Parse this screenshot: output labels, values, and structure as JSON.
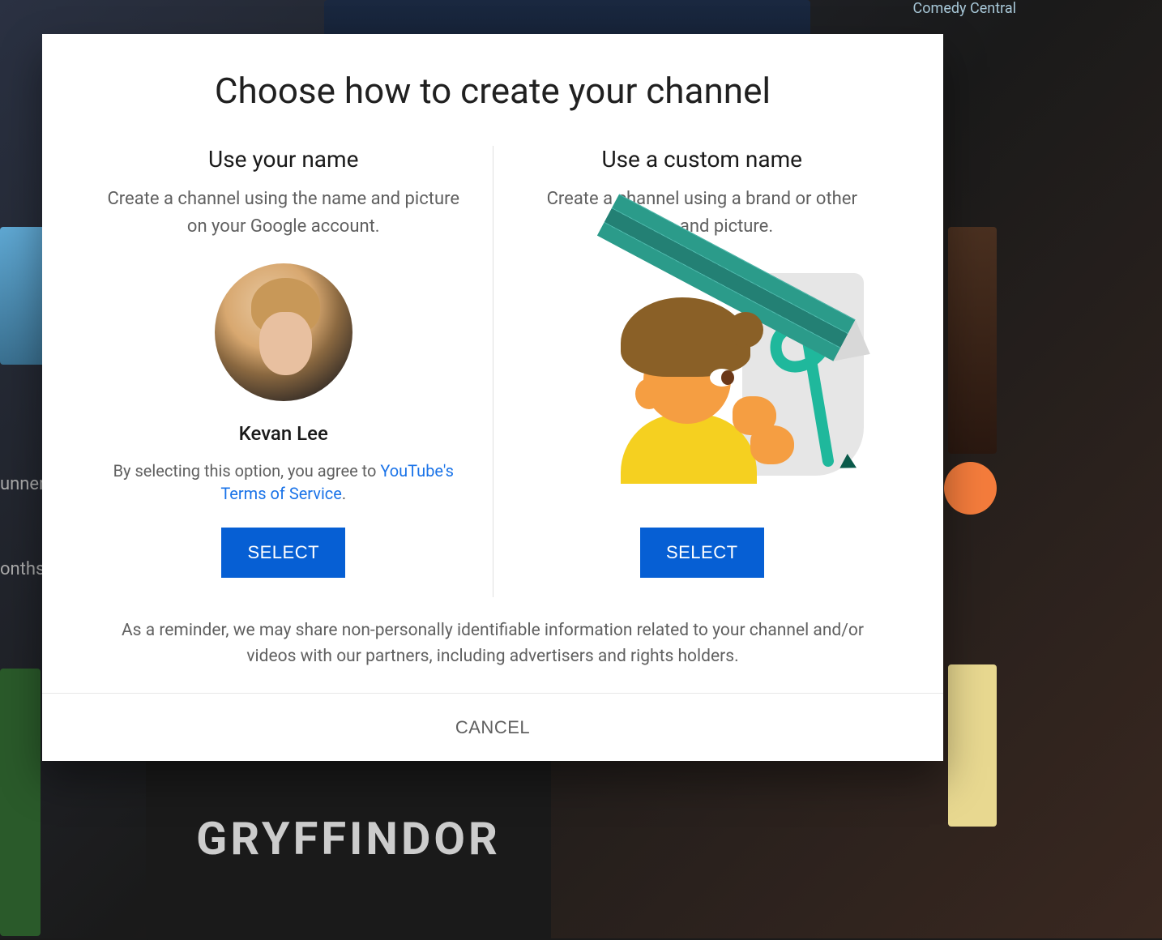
{
  "modal": {
    "title": "Choose how to create your channel",
    "options": {
      "use_name": {
        "heading": "Use your name",
        "description": "Create a channel using the name and picture on your Google account.",
        "user_name": "Kevan Lee",
        "agree_prefix": "By selecting this option, you agree to ",
        "tos_link_text": "YouTube's Terms of Service",
        "agree_suffix": ".",
        "select_label": "SELECT"
      },
      "custom_name": {
        "heading": "Use a custom name",
        "description": "Create a channel using a brand or other name and picture.",
        "select_label": "SELECT"
      }
    },
    "reminder": "As a reminder, we may share non-personally identifiable information related to your channel and/or videos with our partners, including advertisers and rights holders.",
    "cancel_label": "CANCEL"
  },
  "backdrop": {
    "label_runner": "unner",
    "label_onths": "onths",
    "label_gryffindor": "GRYFFINDOR",
    "label_comedy": "Comedy Central"
  }
}
